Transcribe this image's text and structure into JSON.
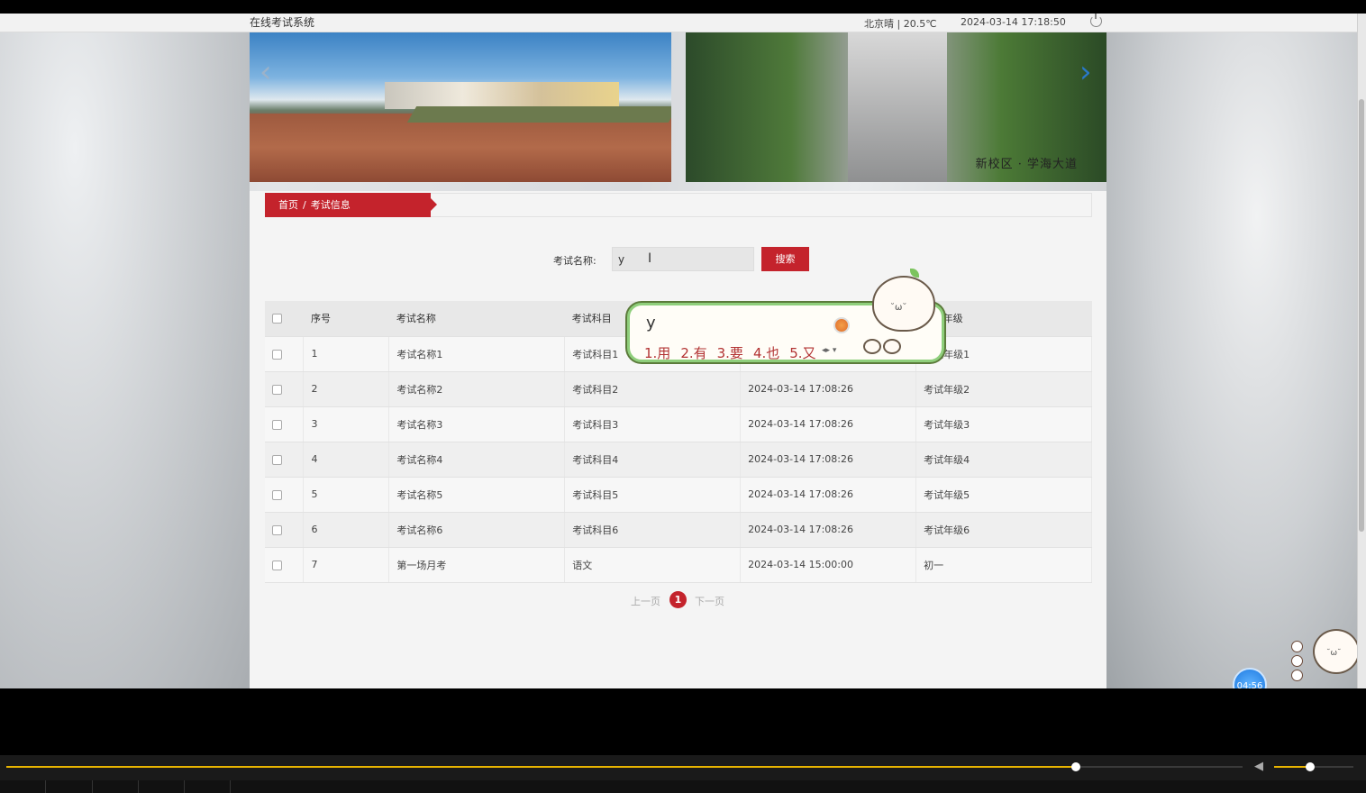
{
  "header": {
    "site_title": "在线考试系统",
    "weather": "北京晴 | 20.5℃",
    "datetime": "2024-03-14   17:18:50"
  },
  "banner": {
    "caption": "新校区 · 学海大道"
  },
  "breadcrumb": {
    "home": "首页",
    "separator": "/",
    "current": "考试信息"
  },
  "search": {
    "label": "考试名称:",
    "value": "y",
    "button": "搜索"
  },
  "table": {
    "headers": [
      "",
      "序号",
      "考试名称",
      "考试科目",
      "",
      "考试年级"
    ],
    "rows": [
      {
        "no": "1",
        "name": "考试名称1",
        "subject": "考试科目1",
        "time": "",
        "grade": "考试年级1"
      },
      {
        "no": "2",
        "name": "考试名称2",
        "subject": "考试科目2",
        "time": "2024-03-14 17:08:26",
        "grade": "考试年级2"
      },
      {
        "no": "3",
        "name": "考试名称3",
        "subject": "考试科目3",
        "time": "2024-03-14 17:08:26",
        "grade": "考试年级3"
      },
      {
        "no": "4",
        "name": "考试名称4",
        "subject": "考试科目4",
        "time": "2024-03-14 17:08:26",
        "grade": "考试年级4"
      },
      {
        "no": "5",
        "name": "考试名称5",
        "subject": "考试科目5",
        "time": "2024-03-14 17:08:26",
        "grade": "考试年级5"
      },
      {
        "no": "6",
        "name": "考试名称6",
        "subject": "考试科目6",
        "time": "2024-03-14 17:08:26",
        "grade": "考试年级6"
      },
      {
        "no": "7",
        "name": "第一场月考",
        "subject": "语文",
        "time": "2024-03-14 15:00:00",
        "grade": "初一"
      }
    ]
  },
  "pager": {
    "prev": "上一页",
    "current": "1",
    "next": "下一页"
  },
  "ime": {
    "composition": "y",
    "candidates": [
      "1.用",
      "2.有",
      "3.要",
      "4.也",
      "5.又"
    ]
  },
  "widget": {
    "timer": "04:56"
  },
  "player": {
    "progress": 0.865,
    "volume": 0.45
  },
  "colors": {
    "accent": "#c4232c",
    "ime_border": "#8fcf7c",
    "progress": "#e8b400"
  }
}
